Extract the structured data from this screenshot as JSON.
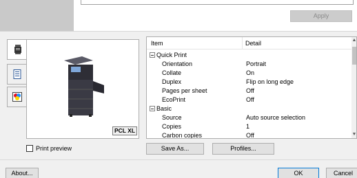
{
  "top": {
    "apply_label": "Apply"
  },
  "tabs": [
    {
      "icon": "printer-icon"
    },
    {
      "icon": "document-icon"
    },
    {
      "icon": "color-icon"
    }
  ],
  "preview": {
    "badge": "PCL XL",
    "print_preview_label": "Print preview",
    "print_preview_checked": false
  },
  "list": {
    "col_item": "Item",
    "col_detail": "Detail",
    "rows": [
      {
        "type": "group",
        "label": "Quick Print",
        "detail": ""
      },
      {
        "type": "item",
        "label": "Orientation",
        "detail": "Portrait"
      },
      {
        "type": "item",
        "label": "Collate",
        "detail": "On"
      },
      {
        "type": "item",
        "label": "Duplex",
        "detail": "Flip on long edge"
      },
      {
        "type": "item",
        "label": "Pages per sheet",
        "detail": "Off"
      },
      {
        "type": "item",
        "label": "EcoPrint",
        "detail": "Off"
      },
      {
        "type": "group",
        "label": "Basic",
        "detail": ""
      },
      {
        "type": "item",
        "label": "Source",
        "detail": "Auto source selection"
      },
      {
        "type": "item",
        "label": "Copies",
        "detail": "1"
      },
      {
        "type": "item",
        "label": "Carbon copies",
        "detail": "Off"
      }
    ]
  },
  "buttons": {
    "save_as": "Save As...",
    "profiles": "Profiles...",
    "about": "About...",
    "ok": "OK",
    "cancel": "Cancel"
  }
}
